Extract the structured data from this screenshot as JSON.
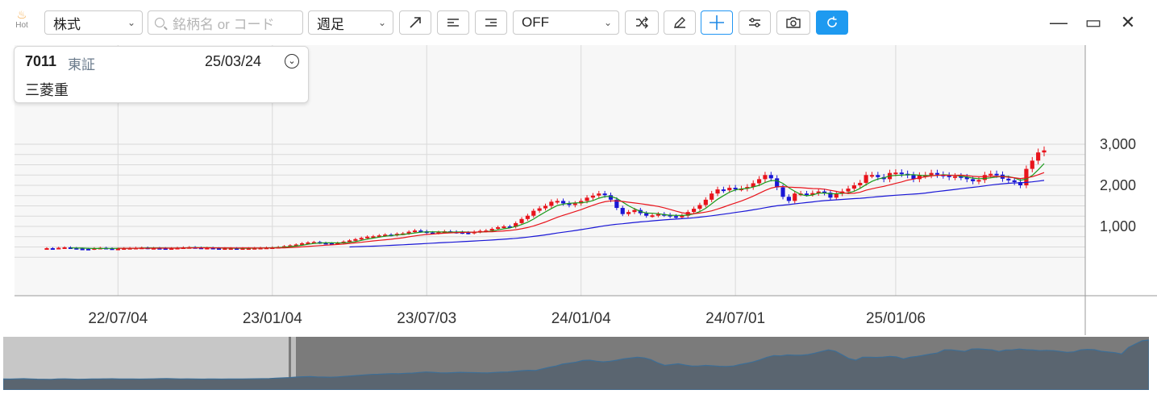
{
  "toolbar": {
    "hot_label": "Hot",
    "market_select": "株式",
    "search_placeholder": "銘柄名 or コード",
    "period_select": "週足",
    "indicator_select": "OFF",
    "accent_color": "#1e9af0"
  },
  "window_controls": {
    "minimize": "—",
    "maximize": "▭",
    "close": "✕"
  },
  "info": {
    "code": "7011",
    "exchange": "東証",
    "date": "25/03/24",
    "name": "三菱重"
  },
  "chart_data": {
    "type": "candlestick",
    "x_labels": [
      "22/07/04",
      "23/01/04",
      "23/07/03",
      "24/01/04",
      "24/07/01",
      "25/01/06"
    ],
    "y_ticks": [
      1000,
      2000,
      3000
    ],
    "y_tick_labels": [
      "1,000",
      "2,000",
      "3,000"
    ],
    "ylim": [
      0,
      3100
    ],
    "grid": true,
    "up_color": "#e8141c",
    "down_color": "#1a17d6",
    "ma_short_color": "#1a9a1a",
    "ma_mid_color": "#e8141c",
    "ma_long_color": "#1a17d6",
    "close": [
      470,
      465,
      480,
      490,
      475,
      460,
      455,
      450,
      470,
      480,
      465,
      455,
      460,
      470,
      475,
      480,
      485,
      470,
      475,
      470,
      465,
      470,
      480,
      490,
      495,
      485,
      475,
      480,
      470,
      465,
      470,
      470,
      465,
      470,
      470,
      475,
      480,
      485,
      490,
      500,
      520,
      540,
      560,
      590,
      610,
      620,
      600,
      590,
      580,
      600,
      630,
      660,
      690,
      720,
      750,
      760,
      780,
      800,
      790,
      820,
      830,
      870,
      900,
      880,
      850,
      840,
      860,
      880,
      870,
      860,
      850,
      840,
      870,
      890,
      900,
      940,
      980,
      1000,
      990,
      1080,
      1180,
      1260,
      1380,
      1440,
      1500,
      1600,
      1620,
      1560,
      1520,
      1560,
      1620,
      1700,
      1750,
      1800,
      1760,
      1650,
      1450,
      1300,
      1350,
      1400,
      1320,
      1260,
      1270,
      1300,
      1280,
      1250,
      1240,
      1260,
      1350,
      1430,
      1520,
      1650,
      1800,
      1900,
      1880,
      1940,
      1920,
      1920,
      1960,
      2050,
      2150,
      2250,
      2170,
      1950,
      1720,
      1620,
      1800,
      1800,
      1790,
      1810,
      1850,
      1820,
      1700,
      1800,
      1850,
      1920,
      2000,
      2060,
      2250,
      2250,
      2200,
      2150,
      2300,
      2310,
      2280,
      2250,
      2150,
      2240,
      2250,
      2300,
      2260,
      2240,
      2200,
      2220,
      2200,
      2150,
      2100,
      2130,
      2250,
      2280,
      2260,
      2160,
      2120,
      2080,
      2000,
      2400,
      2600,
      2800,
      2850
    ]
  }
}
